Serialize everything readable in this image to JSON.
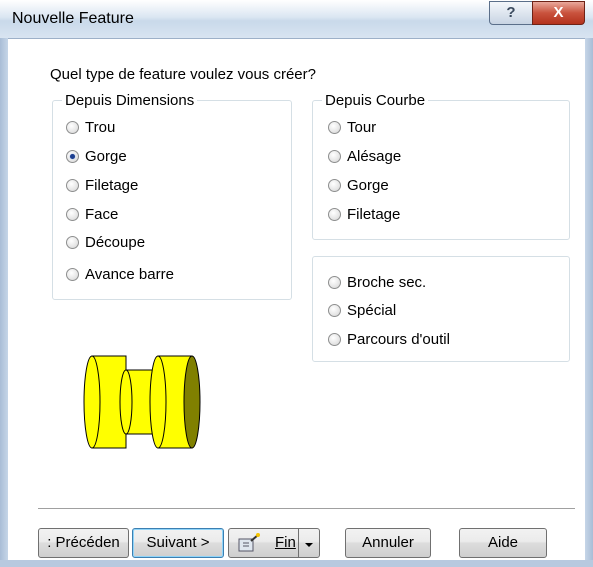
{
  "window": {
    "title": "Nouvelle Feature",
    "help_glyph": "?",
    "close_glyph": "X"
  },
  "prompt": "Quel type de feature voulez vous créer?",
  "groups": {
    "dimensions": {
      "legend": "Depuis Dimensions",
      "options": [
        {
          "label": "Trou",
          "checked": false
        },
        {
          "label": "Gorge",
          "checked": true
        },
        {
          "label": "Filetage",
          "checked": false
        },
        {
          "label": "Face",
          "checked": false
        },
        {
          "label": "Découpe",
          "checked": false
        },
        {
          "label": "Avance barre",
          "checked": false
        }
      ]
    },
    "courbe": {
      "legend": "Depuis Courbe",
      "options": [
        {
          "label": "Tour",
          "checked": false
        },
        {
          "label": "Alésage",
          "checked": false
        },
        {
          "label": "Gorge",
          "checked": false
        },
        {
          "label": "Filetage",
          "checked": false
        }
      ]
    },
    "other": {
      "options": [
        {
          "label": "Broche sec.",
          "checked": false
        },
        {
          "label": "Spécial",
          "checked": false
        },
        {
          "label": "Parcours d'outil",
          "checked": false
        }
      ]
    }
  },
  "buttons": {
    "previous": ": Précéden",
    "next": "Suivant >",
    "finish": "Fin",
    "cancel": "Annuler",
    "help": "Aide"
  },
  "colors": {
    "part_fill": "#ffff00",
    "part_shade": "#808000",
    "accent": "#1d3f8f"
  }
}
